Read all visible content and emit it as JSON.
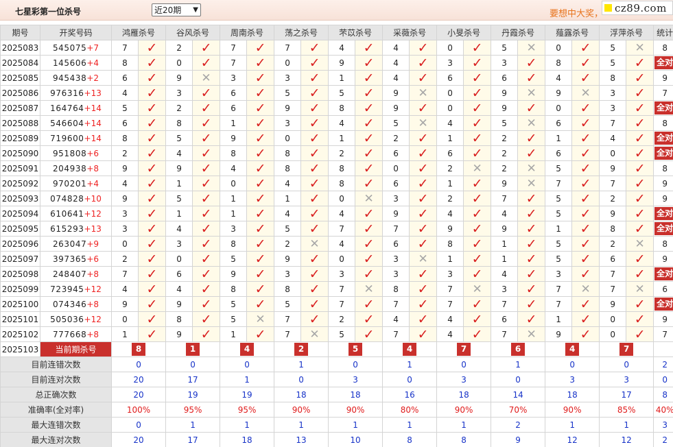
{
  "header": {
    "title": "七星彩第一位杀号",
    "period_select": "近20期",
    "marquee": "要想中大奖，",
    "logo": "cz89.com"
  },
  "table": {
    "columns": [
      "期号",
      "开奖号码",
      "鸿雁杀号",
      "谷风杀号",
      "周南杀号",
      "荡之杀号",
      "芣苡杀号",
      "采薇杀号",
      "小旻杀号",
      "丹霞杀号",
      "薤露杀号",
      "浮萍杀号",
      "统计"
    ],
    "rows": [
      {
        "p": "2025083",
        "n": "545075",
        "s": "+7",
        "k": [
          [
            "7",
            1
          ],
          [
            "2",
            1
          ],
          [
            "7",
            1
          ],
          [
            "7",
            1
          ],
          [
            "4",
            1
          ],
          [
            "4",
            1
          ],
          [
            "0",
            1
          ],
          [
            "5",
            0
          ],
          [
            "0",
            1
          ],
          [
            "5",
            0
          ]
        ],
        "st": "8"
      },
      {
        "p": "2025084",
        "n": "145606",
        "s": "+4",
        "k": [
          [
            "8",
            1
          ],
          [
            "0",
            1
          ],
          [
            "7",
            1
          ],
          [
            "0",
            1
          ],
          [
            "9",
            1
          ],
          [
            "4",
            1
          ],
          [
            "3",
            1
          ],
          [
            "3",
            1
          ],
          [
            "8",
            1
          ],
          [
            "5",
            1
          ]
        ],
        "st": "全对"
      },
      {
        "p": "2025085",
        "n": "945438",
        "s": "+2",
        "k": [
          [
            "6",
            1
          ],
          [
            "9",
            0
          ],
          [
            "3",
            1
          ],
          [
            "3",
            1
          ],
          [
            "1",
            1
          ],
          [
            "4",
            1
          ],
          [
            "6",
            1
          ],
          [
            "6",
            1
          ],
          [
            "4",
            1
          ],
          [
            "8",
            1
          ]
        ],
        "st": "9"
      },
      {
        "p": "2025086",
        "n": "976316",
        "s": "+13",
        "k": [
          [
            "4",
            1
          ],
          [
            "3",
            1
          ],
          [
            "6",
            1
          ],
          [
            "5",
            1
          ],
          [
            "5",
            1
          ],
          [
            "9",
            0
          ],
          [
            "0",
            1
          ],
          [
            "9",
            0
          ],
          [
            "9",
            0
          ],
          [
            "3",
            1
          ]
        ],
        "st": "7"
      },
      {
        "p": "2025087",
        "n": "164764",
        "s": "+14",
        "k": [
          [
            "5",
            1
          ],
          [
            "2",
            1
          ],
          [
            "6",
            1
          ],
          [
            "9",
            1
          ],
          [
            "8",
            1
          ],
          [
            "9",
            1
          ],
          [
            "0",
            1
          ],
          [
            "9",
            1
          ],
          [
            "0",
            1
          ],
          [
            "3",
            1
          ]
        ],
        "st": "全对"
      },
      {
        "p": "2025088",
        "n": "546604",
        "s": "+14",
        "k": [
          [
            "6",
            1
          ],
          [
            "8",
            1
          ],
          [
            "1",
            1
          ],
          [
            "3",
            1
          ],
          [
            "4",
            1
          ],
          [
            "5",
            0
          ],
          [
            "4",
            1
          ],
          [
            "5",
            0
          ],
          [
            "6",
            1
          ],
          [
            "7",
            1
          ]
        ],
        "st": "8"
      },
      {
        "p": "2025089",
        "n": "719600",
        "s": "+14",
        "k": [
          [
            "8",
            1
          ],
          [
            "5",
            1
          ],
          [
            "9",
            1
          ],
          [
            "0",
            1
          ],
          [
            "1",
            1
          ],
          [
            "2",
            1
          ],
          [
            "1",
            1
          ],
          [
            "2",
            1
          ],
          [
            "1",
            1
          ],
          [
            "4",
            1
          ]
        ],
        "st": "全对"
      },
      {
        "p": "2025090",
        "n": "951808",
        "s": "+6",
        "k": [
          [
            "2",
            1
          ],
          [
            "4",
            1
          ],
          [
            "8",
            1
          ],
          [
            "8",
            1
          ],
          [
            "2",
            1
          ],
          [
            "6",
            1
          ],
          [
            "6",
            1
          ],
          [
            "2",
            1
          ],
          [
            "6",
            1
          ],
          [
            "0",
            1
          ]
        ],
        "st": "全对"
      },
      {
        "p": "2025091",
        "n": "204938",
        "s": "+8",
        "k": [
          [
            "9",
            1
          ],
          [
            "9",
            1
          ],
          [
            "4",
            1
          ],
          [
            "8",
            1
          ],
          [
            "8",
            1
          ],
          [
            "0",
            1
          ],
          [
            "2",
            0
          ],
          [
            "2",
            0
          ],
          [
            "5",
            1
          ],
          [
            "9",
            1
          ]
        ],
        "st": "8"
      },
      {
        "p": "2025092",
        "n": "970201",
        "s": "+4",
        "k": [
          [
            "4",
            1
          ],
          [
            "1",
            1
          ],
          [
            "0",
            1
          ],
          [
            "4",
            1
          ],
          [
            "8",
            1
          ],
          [
            "6",
            1
          ],
          [
            "1",
            1
          ],
          [
            "9",
            0
          ],
          [
            "7",
            1
          ],
          [
            "7",
            1
          ]
        ],
        "st": "9"
      },
      {
        "p": "2025093",
        "n": "074828",
        "s": "+10",
        "k": [
          [
            "9",
            1
          ],
          [
            "5",
            1
          ],
          [
            "1",
            1
          ],
          [
            "1",
            1
          ],
          [
            "0",
            0
          ],
          [
            "3",
            1
          ],
          [
            "2",
            1
          ],
          [
            "7",
            1
          ],
          [
            "5",
            1
          ],
          [
            "2",
            1
          ]
        ],
        "st": "9"
      },
      {
        "p": "2025094",
        "n": "610641",
        "s": "+12",
        "k": [
          [
            "3",
            1
          ],
          [
            "1",
            1
          ],
          [
            "1",
            1
          ],
          [
            "4",
            1
          ],
          [
            "4",
            1
          ],
          [
            "9",
            1
          ],
          [
            "4",
            1
          ],
          [
            "4",
            1
          ],
          [
            "5",
            1
          ],
          [
            "9",
            1
          ]
        ],
        "st": "全对"
      },
      {
        "p": "2025095",
        "n": "615293",
        "s": "+13",
        "k": [
          [
            "3",
            1
          ],
          [
            "4",
            1
          ],
          [
            "3",
            1
          ],
          [
            "5",
            1
          ],
          [
            "7",
            1
          ],
          [
            "7",
            1
          ],
          [
            "9",
            1
          ],
          [
            "9",
            1
          ],
          [
            "1",
            1
          ],
          [
            "8",
            1
          ]
        ],
        "st": "全对"
      },
      {
        "p": "2025096",
        "n": "263047",
        "s": "+9",
        "k": [
          [
            "0",
            1
          ],
          [
            "3",
            1
          ],
          [
            "8",
            1
          ],
          [
            "2",
            0
          ],
          [
            "4",
            1
          ],
          [
            "6",
            1
          ],
          [
            "8",
            1
          ],
          [
            "1",
            1
          ],
          [
            "5",
            1
          ],
          [
            "2",
            0
          ]
        ],
        "st": "8"
      },
      {
        "p": "2025097",
        "n": "397365",
        "s": "+6",
        "k": [
          [
            "2",
            1
          ],
          [
            "0",
            1
          ],
          [
            "5",
            1
          ],
          [
            "9",
            1
          ],
          [
            "0",
            1
          ],
          [
            "3",
            0
          ],
          [
            "1",
            1
          ],
          [
            "1",
            1
          ],
          [
            "5",
            1
          ],
          [
            "6",
            1
          ]
        ],
        "st": "9"
      },
      {
        "p": "2025098",
        "n": "248407",
        "s": "+8",
        "k": [
          [
            "7",
            1
          ],
          [
            "6",
            1
          ],
          [
            "9",
            1
          ],
          [
            "3",
            1
          ],
          [
            "3",
            1
          ],
          [
            "3",
            1
          ],
          [
            "3",
            1
          ],
          [
            "4",
            1
          ],
          [
            "3",
            1
          ],
          [
            "7",
            1
          ]
        ],
        "st": "全对"
      },
      {
        "p": "2025099",
        "n": "723945",
        "s": "+12",
        "k": [
          [
            "4",
            1
          ],
          [
            "4",
            1
          ],
          [
            "8",
            1
          ],
          [
            "8",
            1
          ],
          [
            "7",
            0
          ],
          [
            "8",
            1
          ],
          [
            "7",
            0
          ],
          [
            "3",
            1
          ],
          [
            "7",
            0
          ],
          [
            "7",
            0
          ]
        ],
        "st": "6"
      },
      {
        "p": "2025100",
        "n": "074346",
        "s": "+8",
        "k": [
          [
            "9",
            1
          ],
          [
            "9",
            1
          ],
          [
            "5",
            1
          ],
          [
            "5",
            1
          ],
          [
            "7",
            1
          ],
          [
            "7",
            1
          ],
          [
            "7",
            1
          ],
          [
            "7",
            1
          ],
          [
            "7",
            1
          ],
          [
            "9",
            1
          ]
        ],
        "st": "全对"
      },
      {
        "p": "2025101",
        "n": "505036",
        "s": "+12",
        "k": [
          [
            "0",
            1
          ],
          [
            "8",
            1
          ],
          [
            "5",
            0
          ],
          [
            "7",
            1
          ],
          [
            "2",
            1
          ],
          [
            "4",
            1
          ],
          [
            "4",
            1
          ],
          [
            "6",
            1
          ],
          [
            "1",
            1
          ],
          [
            "0",
            1
          ]
        ],
        "st": "9"
      },
      {
        "p": "2025102",
        "n": "777668",
        "s": "+8",
        "k": [
          [
            "1",
            1
          ],
          [
            "9",
            1
          ],
          [
            "1",
            1
          ],
          [
            "7",
            0
          ],
          [
            "5",
            1
          ],
          [
            "7",
            1
          ],
          [
            "4",
            1
          ],
          [
            "7",
            0
          ],
          [
            "9",
            1
          ],
          [
            "0",
            1
          ]
        ],
        "st": "7"
      }
    ],
    "current": {
      "period": "2025103",
      "label": "当前期杀号",
      "kills": [
        "8",
        "1",
        "4",
        "2",
        "5",
        "4",
        "7",
        "6",
        "4",
        "7"
      ]
    },
    "summary": [
      {
        "label": "目前连错次数",
        "vals": [
          "0",
          "0",
          "0",
          "1",
          "0",
          "1",
          "0",
          "1",
          "0",
          "0",
          "2"
        ],
        "color": "blue"
      },
      {
        "label": "目前连对次数",
        "vals": [
          "20",
          "17",
          "1",
          "0",
          "3",
          "0",
          "3",
          "0",
          "3",
          "3",
          "0"
        ],
        "color": "blue"
      },
      {
        "label": "总正确次数",
        "vals": [
          "20",
          "19",
          "19",
          "18",
          "18",
          "16",
          "18",
          "14",
          "18",
          "17",
          "8"
        ],
        "color": "blue"
      },
      {
        "label": "准确率(全对率)",
        "vals": [
          "100%",
          "95%",
          "95%",
          "90%",
          "90%",
          "80%",
          "90%",
          "70%",
          "90%",
          "85%",
          "40%"
        ],
        "color": "red"
      },
      {
        "label": "最大连错次数",
        "vals": [
          "0",
          "1",
          "1",
          "1",
          "1",
          "1",
          "1",
          "2",
          "1",
          "1",
          "3"
        ],
        "color": "blue"
      },
      {
        "label": "最大连对次数",
        "vals": [
          "20",
          "17",
          "18",
          "13",
          "10",
          "8",
          "8",
          "9",
          "12",
          "12",
          "2"
        ],
        "color": "blue"
      }
    ],
    "check_symbol": "✓",
    "cross_symbol": "✕"
  },
  "colors": {
    "accent_red": "#c9302c",
    "check_red": "#d91f1f",
    "value_blue": "#1733c8",
    "marquee_orange": "#e8731c"
  }
}
